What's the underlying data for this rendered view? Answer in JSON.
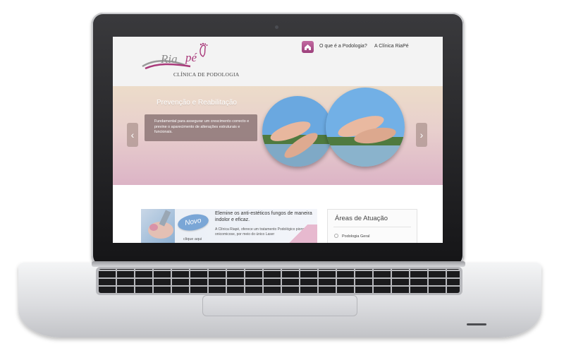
{
  "site": {
    "logo": {
      "ria": "Ria",
      "pe": "pé",
      "subtitle": "CLÍNICA DE PODOLOGIA"
    },
    "nav": {
      "link1": "O que é a Podologia?",
      "link2": "A Clínica RiaPé"
    },
    "banner": {
      "title": "Prevenção e Reabilitação",
      "text": "Fundamental para assegurar um crescimento correcto e previne o aparecimento de alterações estruturais e funcionais.",
      "prev_arrow": "‹",
      "next_arrow": "›"
    },
    "promo": {
      "badge": "Novo",
      "headline": "Elemine os anti-estéticos fungos de maneira indolor e eficaz.",
      "text": "A Clínica Riapé, oferece um tratamento Podológico pioneiro de onicomicose, por meio do único Laser",
      "link": "clique aqui"
    },
    "areas": {
      "title": "Áreas de Atuação",
      "item1": "Podologia Geral"
    }
  },
  "colors": {
    "brand_pink": "#a9397a",
    "banner_top": "#ecdcc9",
    "banner_bottom": "#dcb4c6",
    "badge_blue": "#7aa6d6"
  },
  "icons": {
    "home": "home-icon",
    "prev": "chevron-left-icon",
    "next": "chevron-right-icon",
    "bullet": "circle-bullet-icon"
  }
}
